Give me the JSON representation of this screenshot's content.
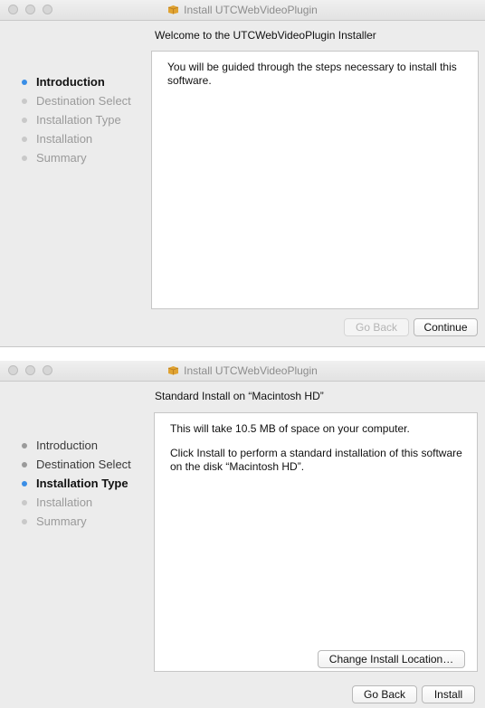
{
  "installer_intro": {
    "window_title": "Install UTCWebVideoPlugin",
    "heading": "Welcome to the UTCWebVideoPlugin Installer",
    "steps": [
      {
        "label": "Introduction",
        "state": "active"
      },
      {
        "label": "Destination Select",
        "state": "pending"
      },
      {
        "label": "Installation Type",
        "state": "pending"
      },
      {
        "label": "Installation",
        "state": "pending"
      },
      {
        "label": "Summary",
        "state": "pending"
      }
    ],
    "body": [
      "You will be guided through the steps necessary to install this software."
    ],
    "go_back_label": "Go Back",
    "continue_label": "Continue"
  },
  "installer_type": {
    "window_title": "Install UTCWebVideoPlugin",
    "heading": "Standard Install on “Macintosh HD”",
    "steps": [
      {
        "label": "Introduction",
        "state": "done"
      },
      {
        "label": "Destination Select",
        "state": "done"
      },
      {
        "label": "Installation Type",
        "state": "active"
      },
      {
        "label": "Installation",
        "state": "pending"
      },
      {
        "label": "Summary",
        "state": "pending"
      }
    ],
    "body": [
      "This will take 10.5 MB of space on your computer.",
      "Click Install to perform a standard installation of this software on the disk “Macintosh HD”."
    ],
    "change_location_label": "Change Install Location…",
    "go_back_label": "Go Back",
    "install_label": "Install"
  },
  "colors": {
    "window_bg": "#ececec",
    "active_dot": "#3a8ee6",
    "package_icon": "#e0a332"
  },
  "icons": {
    "title_icon": "package-icon"
  }
}
